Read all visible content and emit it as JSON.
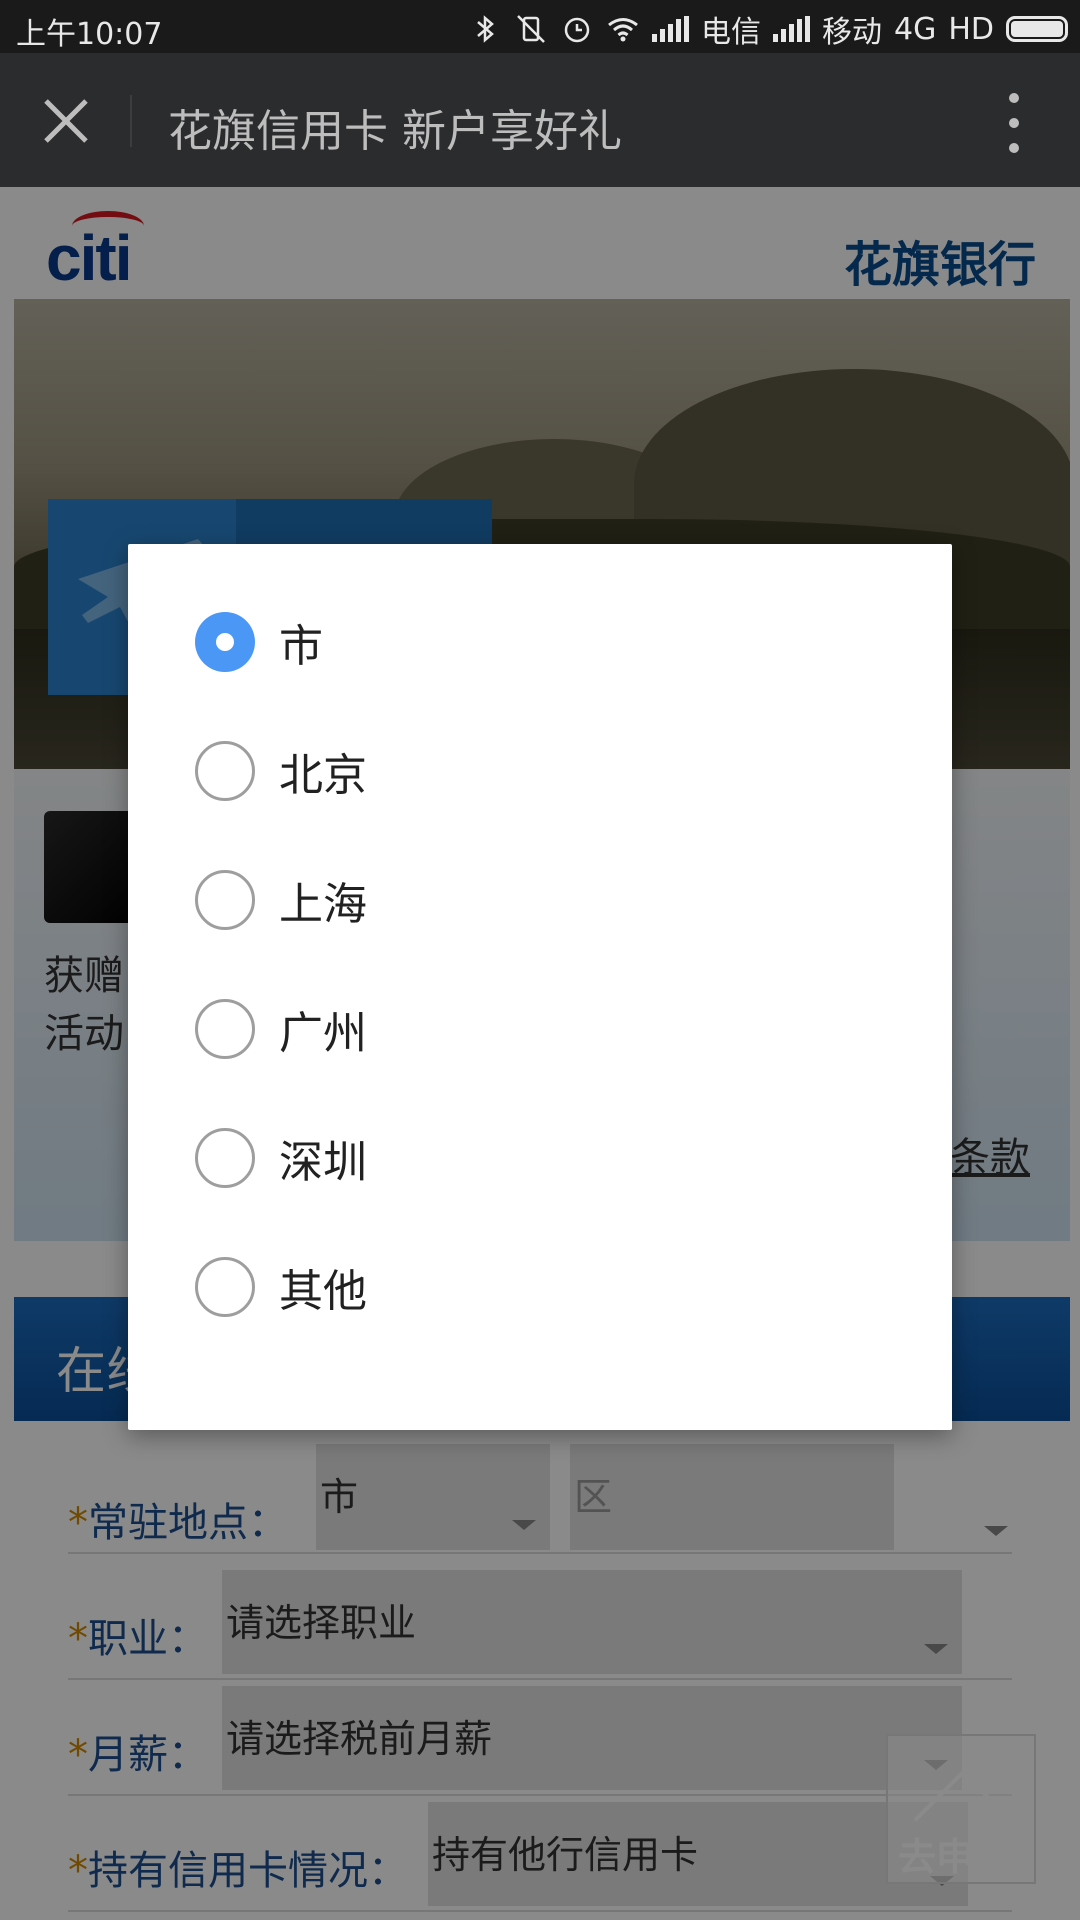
{
  "status_bar": {
    "time": "上午10:07",
    "carrier1": "电信",
    "carrier2": "移动",
    "network": "4G",
    "hd": "HD"
  },
  "title_bar": {
    "title": "花旗信用卡 新户享好礼"
  },
  "header": {
    "logo_text": "citi",
    "bank_name": "花旗银行"
  },
  "card_section": {
    "line1": "获赠",
    "line2": "活动",
    "terms_link": "条款"
  },
  "online_bar": {
    "label": "在线"
  },
  "form": {
    "residence_label": "常驻地点：",
    "residence_city": "市",
    "residence_district": "区",
    "occupation_label": "职业：",
    "occupation_value": "请选择职业",
    "salary_label": "月薪：",
    "salary_value": "请选择税前月薪",
    "card_status_label": "持有信用卡情况：",
    "card_status_value": "持有他行信用卡",
    "required_mark": "*"
  },
  "apply_button": {
    "label": "去申请"
  },
  "dialog": {
    "options": [
      {
        "label": "市",
        "selected": true
      },
      {
        "label": "北京",
        "selected": false
      },
      {
        "label": "上海",
        "selected": false
      },
      {
        "label": "广州",
        "selected": false
      },
      {
        "label": "深圳",
        "selected": false
      },
      {
        "label": "其他",
        "selected": false
      }
    ]
  },
  "colors": {
    "accent": "#4a97f5",
    "label_blue": "#1c4f8f",
    "required": "#d08a00"
  }
}
